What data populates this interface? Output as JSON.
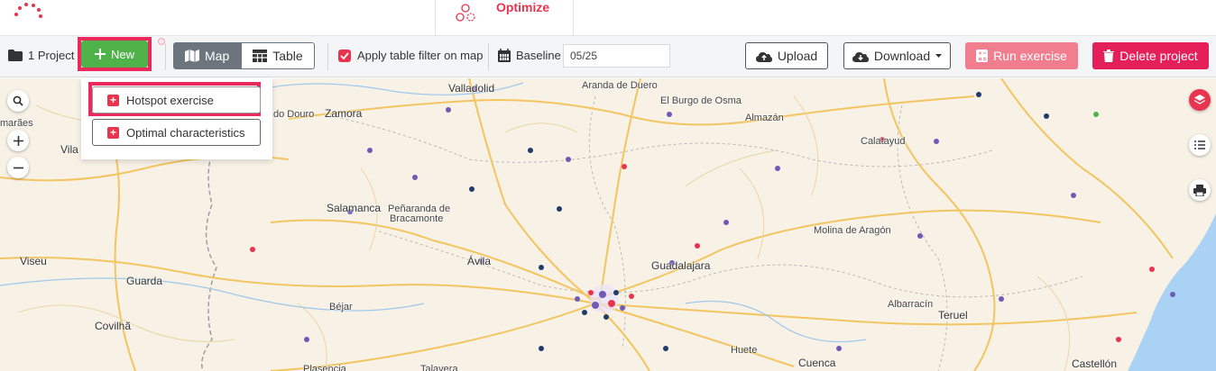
{
  "header": {
    "app_name": "Optimize"
  },
  "toolbar": {
    "project_label": "1 Project",
    "new_label": "New",
    "view_options": [
      {
        "label": "Map",
        "active": true
      },
      {
        "label": "Table",
        "active": false
      }
    ],
    "apply_filter_label": "Apply table filter on map",
    "apply_filter_checked": true,
    "baseline_label": "Baseline",
    "baseline_value": "05/25",
    "upload_label": "Upload",
    "download_label": "Download",
    "run_label": "Run exercise",
    "delete_label": "Delete project"
  },
  "new_menu": {
    "items": [
      {
        "label": "Hotspot exercise"
      },
      {
        "label": "Optimal characteristics"
      }
    ]
  },
  "map": {
    "places": [
      "marães",
      "Vila",
      "Viseu",
      "Guarda",
      "Covilhã",
      "do Douro",
      "Zamora",
      "Valladolid",
      "Salamanca",
      "Peñaranda de",
      "Bracamonte",
      "Aranda de Duero",
      "El Burgo de Osma",
      "Almazán",
      "Calatayud",
      "Molina de Aragón",
      "Guadalajara",
      "Albarracín",
      "Teruel",
      "Huete",
      "Cuenca",
      "Castellón",
      "Talavera",
      "Plasencia",
      "Ávila",
      "Béjar"
    ]
  },
  "colors": {
    "brand": "#e8344e",
    "new_button": "#4fb34a",
    "delete_button": "#e41f5a",
    "run_button": "#f07e8f",
    "highlight": "#ea2a5c",
    "sea": "#a9d2f5",
    "map_bg": "#f7f1e6"
  },
  "icons": {
    "folder": "folder-icon",
    "plus": "plus-icon",
    "map": "map-icon",
    "table": "table-icon",
    "calendar": "calendar-icon",
    "upload": "cloud-upload-icon",
    "download": "cloud-download-icon",
    "run": "calculator-icon",
    "delete": "trash-icon",
    "layers": "layers-icon",
    "list": "list-icon",
    "print": "print-icon",
    "search": "search-icon",
    "zoom_in": "zoom-in-icon",
    "zoom_out": "zoom-out-icon"
  }
}
